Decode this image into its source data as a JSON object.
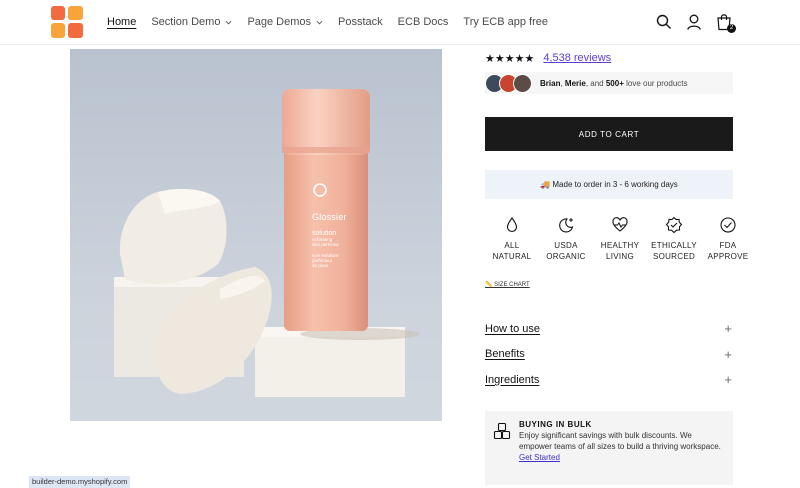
{
  "header": {
    "nav": [
      {
        "label": "Home",
        "active": true,
        "dropdown": false
      },
      {
        "label": "Section Demo",
        "active": false,
        "dropdown": true
      },
      {
        "label": "Page Demos",
        "active": false,
        "dropdown": true
      },
      {
        "label": "Posstack",
        "active": false,
        "dropdown": false
      },
      {
        "label": "ECB Docs",
        "active": false,
        "dropdown": false
      },
      {
        "label": "Try ECB app free",
        "active": false,
        "dropdown": false
      }
    ],
    "icons": [
      "search-icon",
      "account-icon",
      "cart-icon"
    ],
    "cart_count": "2"
  },
  "product_image": {
    "brand_mark": "G",
    "brand": "Glossier",
    "line1": "solution",
    "line2": "exfoliating",
    "line3": "skin perfector",
    "line4": "soin exfoliant",
    "line5": "perfecteur",
    "line6": "de peau"
  },
  "product": {
    "stars": "★★★★★",
    "reviews": "4,538 reviews",
    "social_name1": "Brian",
    "social_sep": ",",
    "social_name2": "Merie",
    "social_and": ", and",
    "social_count": "500+",
    "social_tail": "love our products",
    "add_to_cart": "ADD TO CART",
    "notice": "🚚 Made to order in 3 - 6 working days",
    "features": [
      {
        "line1": "ALL",
        "line2": "NATURAL",
        "icon": "drop-icon"
      },
      {
        "line1": "USDA",
        "line2": "ORGANIC",
        "icon": "moon-star-icon"
      },
      {
        "line1": "HEALTHY",
        "line2": "LIVING",
        "icon": "heart-pulse-icon"
      },
      {
        "line1": "ETHICALLY",
        "line2": "SOURCED",
        "icon": "badge-check-icon"
      },
      {
        "line1": "FDA",
        "line2": "APPROVE",
        "icon": "circle-check-icon"
      }
    ],
    "size_chart": "📏 SIZE CHART",
    "accordion": [
      "How to use",
      "Benefits",
      "Ingredients"
    ],
    "bulk": {
      "title": "BUYING IN BULK",
      "body": "Enjoy significant savings with bulk discounts. We empower teams of all sizes to build a thriving workspace.",
      "link": "Get Started"
    }
  },
  "status_url": "builder-demo.myshopify.com",
  "colors": {
    "accent_link": "#5a3fd1",
    "button_bg": "#1a1a1a",
    "notice_bg": "#eef2f9",
    "logo_orange": "#f26a3d",
    "bottle": "#f2b6a0"
  }
}
